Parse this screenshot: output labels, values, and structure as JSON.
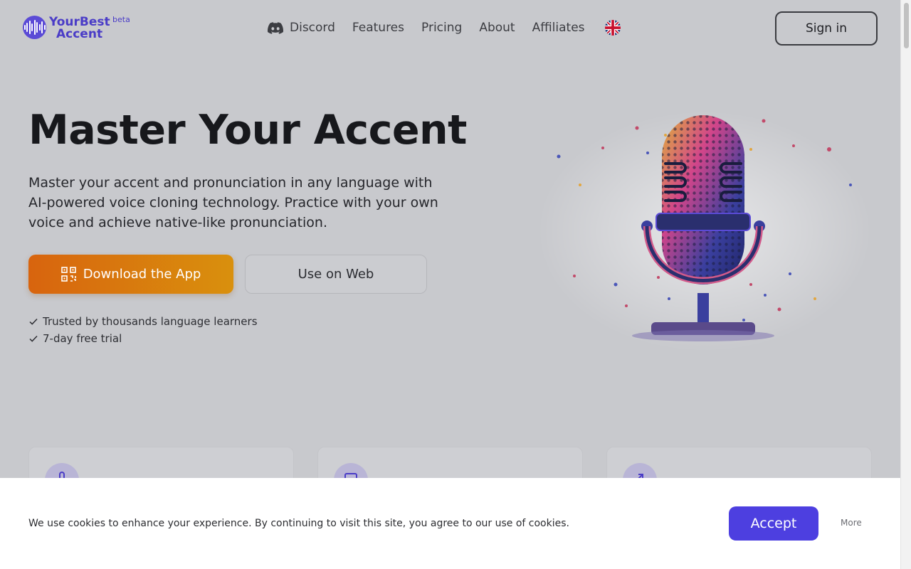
{
  "brand": {
    "line1": "YourBest",
    "line2": "Accent",
    "tag": "beta",
    "color": "#4a3cc7"
  },
  "nav": {
    "items": [
      {
        "label": "Discord",
        "icon": "discord-icon"
      },
      {
        "label": "Features"
      },
      {
        "label": "Pricing"
      },
      {
        "label": "About"
      },
      {
        "label": "Affiliates"
      }
    ],
    "language_icon": "uk-flag-icon"
  },
  "header": {
    "signin_label": "Sign in"
  },
  "hero": {
    "title": "Master Your Accent",
    "subtitle": "Master your accent and pronunciation in any language with AI-powered voice cloning technology. Practice with your own voice and achieve native-like pronunciation.",
    "download_label": "Download the App",
    "download_icon": "qr-code-icon",
    "web_label": "Use on Web",
    "trust": [
      "Trusted by thousands language learners",
      "7-day free trial"
    ],
    "art_icon": "microphone-soundwave-illustration",
    "accent_colors": [
      "#d8640e",
      "#d9900d"
    ]
  },
  "features": {
    "card_icons": [
      "microphone-icon",
      "screen-icon",
      "arrow-icon"
    ]
  },
  "cookie": {
    "text": "We use cookies to enhance your experience. By continuing to visit this site, you agree to our use of cookies.",
    "accept_label": "Accept",
    "more_label": "More",
    "accept_color": "#4d3fe0"
  }
}
